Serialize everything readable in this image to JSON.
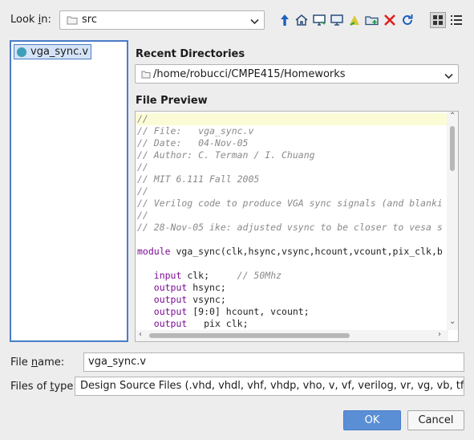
{
  "look_in": {
    "label_pre": "Look ",
    "label_mn": "i",
    "label_post": "n:",
    "value": "src"
  },
  "toolbar": {
    "icons": [
      "up-arrow-icon",
      "home-icon",
      "desktop-icon",
      "computer-icon",
      "shortcut-icon",
      "new-folder-icon",
      "delete-icon",
      "refresh-icon",
      "list-view-icon",
      "details-view-icon"
    ],
    "colors": {
      "up": "#1f5fbf",
      "delete": "#e0201b",
      "refresh": "#1f5fbf"
    }
  },
  "file_list": {
    "items": [
      {
        "name": "vga_sync.v"
      }
    ]
  },
  "recent": {
    "title": "Recent Directories",
    "value": "/home/robucci/CMPE415/Homeworks"
  },
  "preview": {
    "title": "File Preview",
    "lines": [
      {
        "c": "//"
      },
      {
        "c": "// File:   vga_sync.v"
      },
      {
        "c": "// Date:   04-Nov-05"
      },
      {
        "c": "// Author: C. Terman / I. Chuang"
      },
      {
        "c": "//"
      },
      {
        "c": "// MIT 6.111 Fall 2005"
      },
      {
        "c": "//"
      },
      {
        "c": "// Verilog code to produce VGA sync signals (and blanki"
      },
      {
        "c": "//"
      },
      {
        "c": "// 28-Nov-05 ike: adjusted vsync to be closer to vesa s"
      },
      {
        "c": ""
      },
      {
        "k": "module",
        "p": " vga_sync(clk,hsync,vsync,hcount,vcount,pix_clk,b"
      },
      {
        "c": ""
      },
      {
        "i": "   ",
        "k": "input",
        "p": " clk;     ",
        "c2": "// 50Mhz"
      },
      {
        "i": "   ",
        "k": "output",
        "p": " hsync;"
      },
      {
        "i": "   ",
        "k": "output",
        "p": " vsync;"
      },
      {
        "i": "   ",
        "k": "output",
        "p": " [9:0] hcount, vcount;"
      },
      {
        "i": "   ",
        "k": "output",
        "p": "   pix_clk;"
      }
    ]
  },
  "file_name": {
    "label_pre": "File ",
    "label_mn": "n",
    "label_post": "ame:",
    "value": "vga_sync.v"
  },
  "file_type": {
    "label_pre": "Files of ",
    "label_mn": "t",
    "label_post": "ype:",
    "value": "Design Source Files (.vhd, vhdl, vhf, vhdp, vho, v, vf, verilog, vr, vg, vb, tf, vlog"
  },
  "buttons": {
    "ok": "OK",
    "cancel": "Cancel"
  }
}
